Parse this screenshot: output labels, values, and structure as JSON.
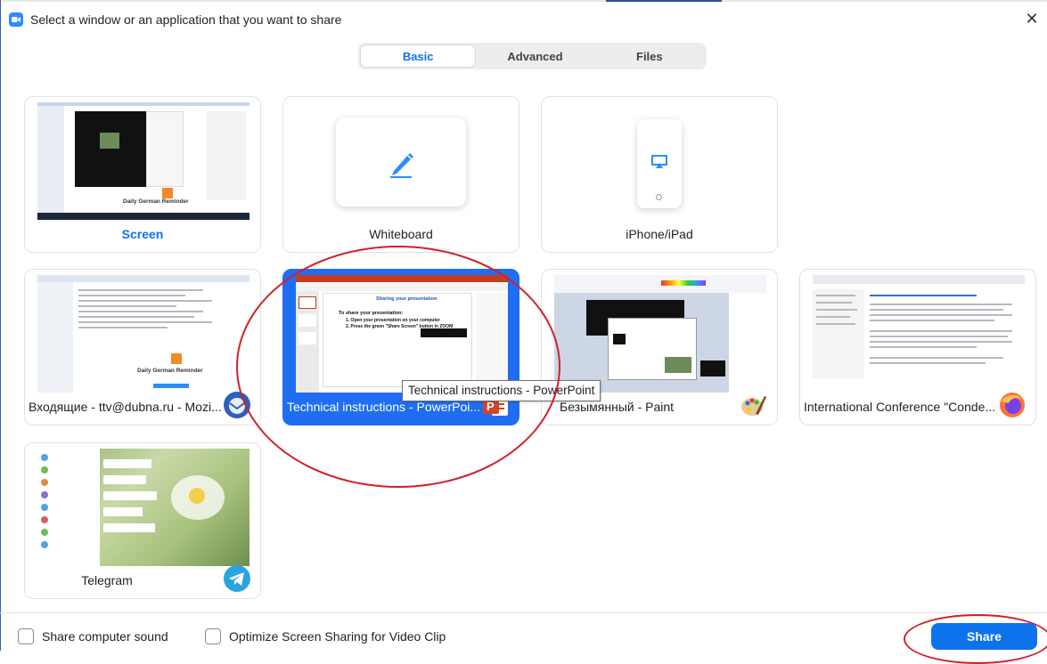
{
  "window": {
    "title": "Select a window or an application that you want to share",
    "close_icon": "close-icon",
    "app_icon": "zoom-app-icon"
  },
  "tabs": [
    {
      "label": "Basic",
      "active": true
    },
    {
      "label": "Advanced",
      "active": false
    },
    {
      "label": "Files",
      "active": false
    }
  ],
  "sources": [
    {
      "label": "Screen",
      "kind": "screen",
      "selected": false
    },
    {
      "label": "Whiteboard",
      "kind": "whiteboard",
      "icon": "pen-icon"
    },
    {
      "label": "iPhone/iPad",
      "kind": "iphone",
      "icon": "airplay-icon"
    },
    {
      "label": "Входящие - ttv@dubna.ru - Mozi...",
      "kind": "window",
      "app_icon": "thunderbird-icon"
    },
    {
      "label": "Technical instructions - PowerPoi...",
      "kind": "window",
      "selected": true,
      "app_icon": "powerpoint-icon"
    },
    {
      "label": "Безымянный - Paint",
      "kind": "window",
      "app_icon": "paint-icon"
    },
    {
      "label": "International Conference \"Conde...",
      "kind": "window",
      "app_icon": "firefox-icon"
    },
    {
      "label": "Telegram",
      "kind": "window",
      "app_icon": "telegram-icon"
    }
  ],
  "thumbnails": {
    "screen_caption": "Daily German Reminder",
    "thunderbird_caption": "Daily German Reminder",
    "ppt_slide_title": "Sharing your presentation",
    "ppt_heading": "To share your presentation:",
    "ppt_step1": "1. Open your presentation on your computer",
    "ppt_step2": "2. Press the green \"Share Screen\" button in ZOOM"
  },
  "tooltip": "Technical instructions - PowerPoint",
  "options": {
    "share_sound": "Share computer sound",
    "optimize_video": "Optimize Screen Sharing for Video Clip"
  },
  "share_button": "Share",
  "colors": {
    "accent": "#0e72ed",
    "selected_card": "#1f6ef2",
    "annotation": "#d21f2a"
  }
}
